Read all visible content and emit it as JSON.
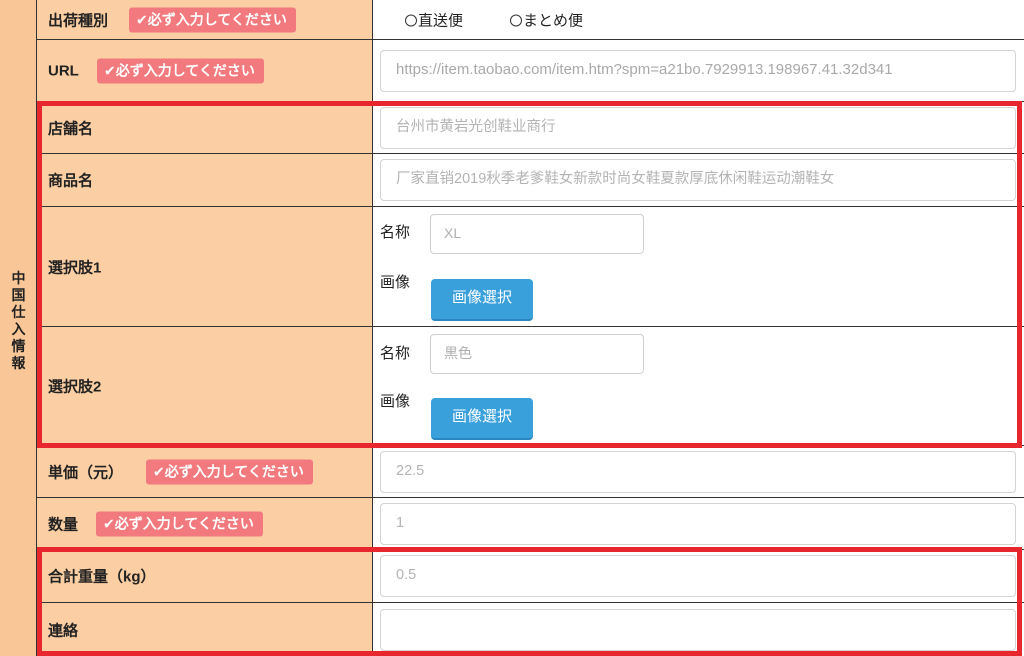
{
  "section_label": [
    "中",
    "国",
    "仕",
    "入",
    "情",
    "報"
  ],
  "required_badge": "✔必ず入力してください",
  "rows": {
    "shipping": {
      "label": "出荷種別",
      "options": [
        "直送便",
        "まとめ便"
      ]
    },
    "url": {
      "label": "URL",
      "value": "https://item.taobao.com/item.htm?spm=a21bo.7929913.198967.41.32d341"
    },
    "shop": {
      "label": "店舗名",
      "value": "台州市黄岩光创鞋业商行"
    },
    "product": {
      "label": "商品名",
      "value": "厂家直销2019秋季老爹鞋女新款时尚女鞋夏款厚底休闲鞋运动潮鞋女"
    },
    "option1": {
      "label": "選択肢1",
      "name_label": "名称",
      "name_value": "XL",
      "image_label": "画像",
      "button": "画像選択"
    },
    "option2": {
      "label": "選択肢2",
      "name_label": "名称",
      "name_value": "黒色",
      "image_label": "画像",
      "button": "画像選択"
    },
    "unit_price": {
      "label": "単価（元）",
      "value": "22.5"
    },
    "quantity": {
      "label": "数量",
      "value": "1"
    },
    "weight": {
      "label": "合計重量（kg）",
      "value": "0.5"
    },
    "contact": {
      "label": "連絡",
      "value": ""
    }
  },
  "colors": {
    "label_bg": "#fbcea3",
    "badge_bg": "#f27a7e",
    "button_bg": "#3aa0dc",
    "highlight": "#e8262d"
  }
}
